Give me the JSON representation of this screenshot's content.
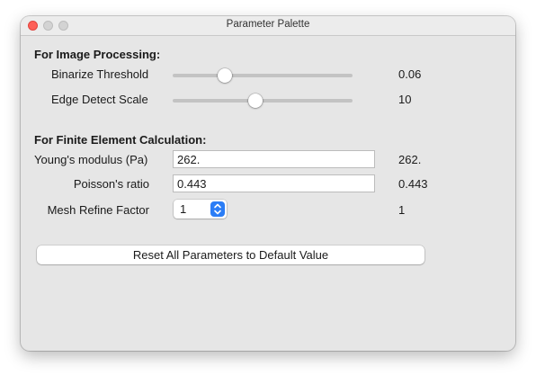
{
  "window": {
    "title": "Parameter Palette"
  },
  "image_processing": {
    "header": "For Image Processing:",
    "sliders": [
      {
        "label": "Binarize Threshold",
        "value_text": "0.06",
        "fraction": 0.29
      },
      {
        "label": "Edge Detect Scale",
        "value_text": "10",
        "fraction": 0.46
      }
    ]
  },
  "fem": {
    "header": "For Finite Element Calculation:",
    "youngs": {
      "label": "Young's modulus (Pa)",
      "input": "262.",
      "value_text": "262."
    },
    "poisson": {
      "label": "Poisson's ratio",
      "input": "0.443",
      "value_text": "0.443"
    },
    "mesh": {
      "label": "Mesh Refine Factor",
      "selected": "1",
      "value_text": "1"
    }
  },
  "reset_button": {
    "label": "Reset All Parameters to Default Value"
  },
  "icons": {
    "close": "close-icon",
    "minimize": "minimize-icon",
    "zoom": "zoom-icon",
    "stepper": "up-down-chevron-icon"
  },
  "colors": {
    "accent": "#2b7df6",
    "close": "#fe5f57"
  }
}
